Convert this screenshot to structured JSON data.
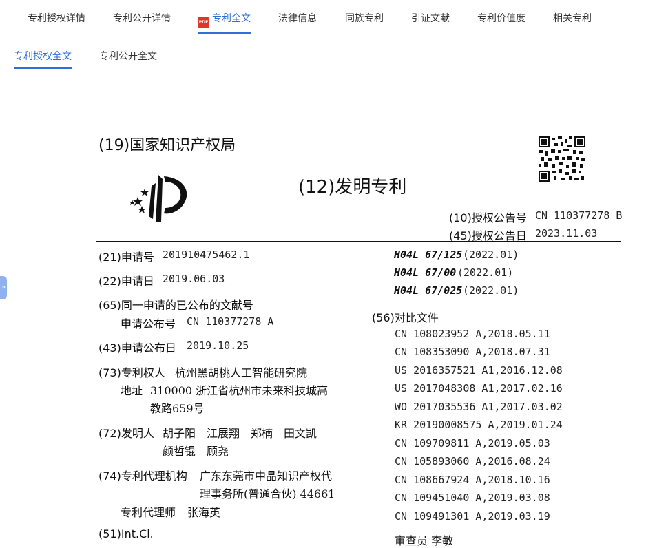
{
  "top_tabs": [
    {
      "label": "专利授权详情"
    },
    {
      "label": "专利公开详情"
    },
    {
      "label": "专利全文",
      "icon": "pdf-icon",
      "icon_text": "PDF"
    },
    {
      "label": "法律信息"
    },
    {
      "label": "同族专利"
    },
    {
      "label": "引证文献"
    },
    {
      "label": "专利价值度"
    },
    {
      "label": "相关专利"
    }
  ],
  "sub_tabs": [
    {
      "label": "专利授权全文"
    },
    {
      "label": "专利公开全文"
    }
  ],
  "colors": {
    "accent": "#2f6fd6",
    "pdf": "#e0352b",
    "side_toggle": "#8fb2ee"
  },
  "doc": {
    "office": "(19)国家知识产权局",
    "type": "(12)发明专利",
    "pub_no_label": "(10)授权公告号",
    "pub_no": "CN 110377278 B",
    "pub_date_label": "(45)授权公告日",
    "pub_date": "2023.11.03",
    "app_no_label": "(21)申请号",
    "app_no": "201910475462.1",
    "app_date_label": "(22)申请日",
    "app_date": "2019.06.03",
    "prior_pub_label": "(65)同一申请的已公布的文献号",
    "prior_pub_sub_label": "申请公布号",
    "prior_pub_no": "CN 110377278 A",
    "app_pub_date_label": "(43)申请公布日",
    "app_pub_date": "2019.10.25",
    "patentee_label": "(73)专利权人",
    "patentee": "杭州黑胡桃人工智能研究院",
    "address_label": "地址",
    "address_line1": "310000 浙江省杭州市未来科技城高",
    "address_line2": "教路659号",
    "inventor_label": "(72)发明人",
    "inventors_line1": "胡子阳　江展翔　郑楠　田文凯",
    "inventors_line2": "颜哲锟　顾尧",
    "agency_label": "(74)专利代理机构",
    "agency_line1": "广东东莞市中晶知识产权代",
    "agency_line2": "理事务所(普通合伙) 44661",
    "agent_label": "专利代理师",
    "agent": "张海英",
    "int_cl_label": "(51)Int.Cl.",
    "ipc": [
      {
        "code": "H04L 67/125",
        "ver": "(2022.01)"
      },
      {
        "code": "H04L 67/00",
        "ver": "(2022.01)"
      },
      {
        "code": "H04L 67/025",
        "ver": "(2022.01)"
      }
    ],
    "cited_label": "(56)对比文件",
    "cited": [
      "CN 108023952 A,2018.05.11",
      "CN 108353090 A,2018.07.31",
      "US 2016357521 A1,2016.12.08",
      "US 2017048308 A1,2017.02.16",
      "WO 2017035536 A1,2017.03.02",
      "KR 20190008575 A,2019.01.24",
      "CN 109709811 A,2019.05.03",
      "CN 105893060 A,2016.08.24",
      "CN 108667924 A,2018.10.16",
      "CN 109451040 A,2019.03.08",
      "CN 109491301 A,2019.03.19"
    ],
    "examiner_partial": "审查员 李敏"
  }
}
